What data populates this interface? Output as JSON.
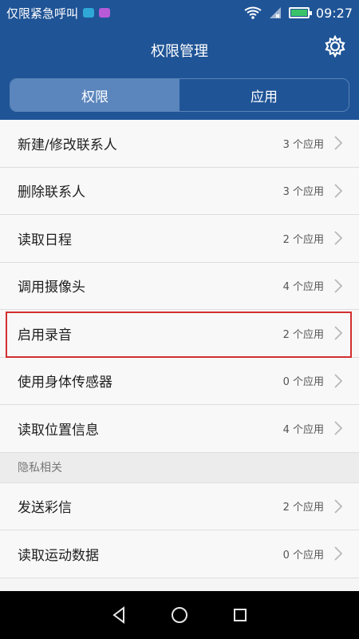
{
  "status_bar": {
    "emergency_text": "仅限紧急呼叫",
    "time": "09:27"
  },
  "header": {
    "title": "权限管理",
    "tabs": [
      {
        "label": "权限",
        "active": true
      },
      {
        "label": "应用",
        "active": false
      }
    ]
  },
  "permissions": [
    {
      "label": "新建/修改联系人",
      "count": "3 个应用"
    },
    {
      "label": "删除联系人",
      "count": "3 个应用"
    },
    {
      "label": "读取日程",
      "count": "2 个应用"
    },
    {
      "label": "调用摄像头",
      "count": "4 个应用"
    },
    {
      "label": "启用录音",
      "count": "2 个应用"
    },
    {
      "label": "使用身体传感器",
      "count": "0 个应用"
    },
    {
      "label": "读取位置信息",
      "count": "4 个应用"
    }
  ],
  "privacy_section": {
    "title": "隐私相关",
    "items": [
      {
        "label": "发送彩信",
        "count": "2 个应用"
      },
      {
        "label": "读取运动数据",
        "count": "0 个应用"
      }
    ]
  },
  "icons": {
    "settings": "gear-icon",
    "back": "back-icon",
    "home": "home-icon",
    "recents": "recents-icon"
  },
  "colors": {
    "header_bg": "#1f5496",
    "tab_active_bg": "#5b86bd",
    "highlight_border": "#d32f2f"
  }
}
